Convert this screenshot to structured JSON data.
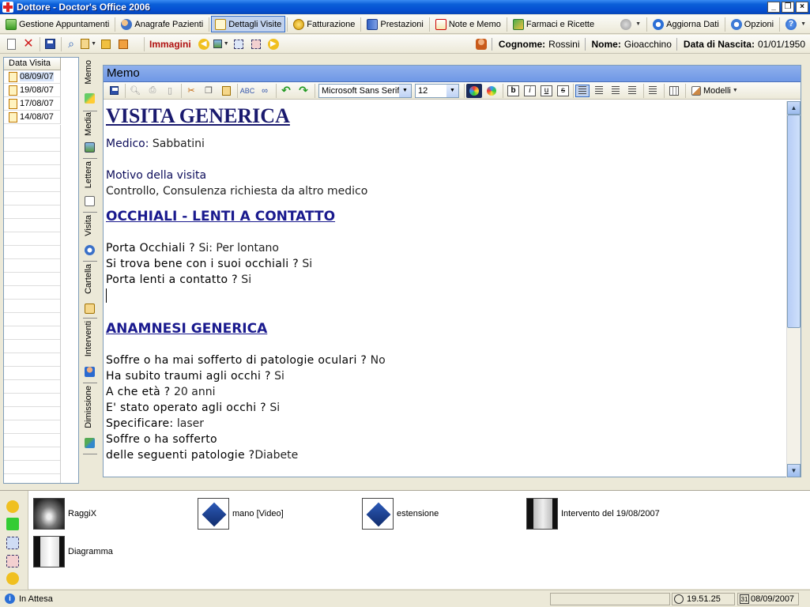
{
  "window": {
    "title": "Dottore - Doctor's Office 2006",
    "buttons": {
      "minimize": "_",
      "maximize": "❐",
      "close": "×"
    }
  },
  "nav": {
    "items": [
      {
        "label": "Gestione Appuntamenti",
        "icon": "calendar-icon"
      },
      {
        "label": "Anagrafe Pazienti",
        "icon": "patients-icon"
      },
      {
        "label": "Dettagli Visite",
        "icon": "visit-details-icon",
        "active": true
      },
      {
        "label": "Fatturazione",
        "icon": "billing-icon"
      },
      {
        "label": "Prestazioni",
        "icon": "services-icon"
      },
      {
        "label": "Note e Memo",
        "icon": "notes-icon"
      },
      {
        "label": "Farmaci e Ricette",
        "icon": "drugs-icon"
      },
      {
        "label": "Aggiorna Dati",
        "icon": "refresh-icon"
      },
      {
        "label": "Opzioni",
        "icon": "options-icon"
      }
    ]
  },
  "toolbar2": {
    "images_label": "Immagini"
  },
  "patient": {
    "surname_label": "Cognome:",
    "surname": "Rossini",
    "name_label": "Nome:",
    "name": "Gioacchino",
    "dob_label": "Data di Nascita:",
    "dob": "01/01/1950"
  },
  "visits": {
    "header": "Data Visita",
    "dates": [
      "08/09/07",
      "19/08/07",
      "17/08/07",
      "14/08/07"
    ]
  },
  "vtabs": [
    "Memo",
    "Media",
    "Lettera",
    "Visita",
    "Cartella",
    "Interventi",
    "Dimissione"
  ],
  "memo": {
    "header": "Memo",
    "font": "Microsoft Sans Serif",
    "size": "12",
    "bold": "b",
    "italic": "i",
    "underline": "u",
    "strike": "s",
    "models": "Modelli",
    "title": "VISITA GENERICA",
    "doctor_label": "Medico:",
    "doctor": " Sabbatini",
    "reason_label": "Motivo della visita",
    "reason": "Controllo, Consulenza richiesta da altro medico",
    "section1": "OCCHIALI - LENTI A CONTATTO",
    "q1": "Porta Occhiali ?",
    "a1": " Si: Per lontano",
    "q2": "Si trova bene con i suoi occhiali ?",
    "a2": "  Si",
    "q3": "Porta lenti a contatto ?",
    "a3": "  Si",
    "section2": "ANAMNESI GENERICA",
    "q4": "Soffre o ha mai sofferto di patologie oculari ?",
    "a4": "  No",
    "q5": "Ha subito traumi agli occhi ?",
    "a5": "  Si",
    "q6": "A che età ?",
    "a6": "  20 anni",
    "q7": "E' stato operato agli occhi ?",
    "a7": "  Si",
    "q8": "Specificare:",
    "a8": "  laser",
    "q9": "Soffre o ha sofferto",
    "q10": "delle seguenti patologie ?",
    "a10": "Diabete"
  },
  "media": {
    "items": [
      {
        "label": "RaggiX",
        "kind": "xray"
      },
      {
        "label": "mano [Video]",
        "kind": "video"
      },
      {
        "label": "estensione",
        "kind": "video"
      },
      {
        "label": "Intervento del 19/08/2007",
        "kind": "scan"
      },
      {
        "label": "Diagramma",
        "kind": "diagram"
      }
    ]
  },
  "status": {
    "text": "In Attesa",
    "time": "19.51.25",
    "date": "08/09/2007",
    "calendar_day": "31"
  },
  "colors": {
    "titlebar": "#0550d2",
    "memo_header": "#7a9fe8",
    "heading_navy": "#1a1a8e",
    "active_tab": "#c1d2ee"
  }
}
